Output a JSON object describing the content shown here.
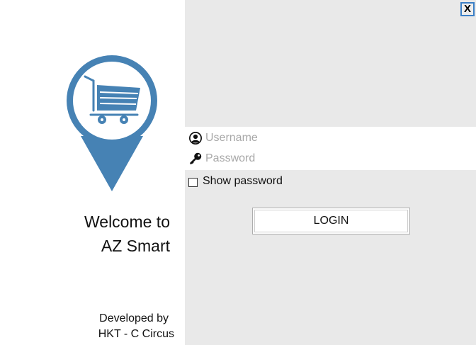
{
  "window": {
    "close_label": "X"
  },
  "branding": {
    "logo_icon": "shopping-cart-map-pin",
    "brand_color": "#4682b4",
    "welcome_line1": "Welcome to",
    "welcome_line2": "AZ Smart",
    "developer_line1": "Developed by",
    "developer_line2": "HKT - C Circus"
  },
  "login": {
    "username": {
      "icon": "user-circle-icon",
      "placeholder": "Username",
      "value": ""
    },
    "password": {
      "icon": "key-icon",
      "placeholder": "Password",
      "value": ""
    },
    "show_password_label": "Show password",
    "show_password_checked": false,
    "submit_label": "LOGIN"
  }
}
